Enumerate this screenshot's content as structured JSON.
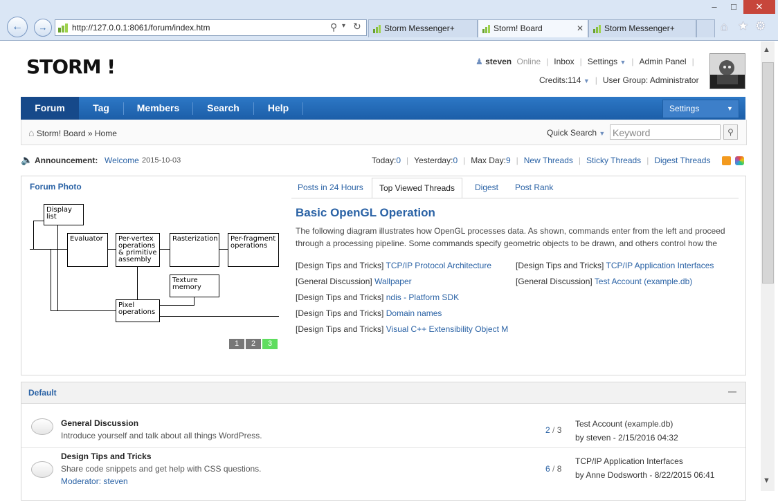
{
  "browser": {
    "url": "http://127.0.0.1:8061/forum/index.htm",
    "tabs": [
      {
        "title": "Storm Messenger+",
        "active": false
      },
      {
        "title": "Storm! Board",
        "active": true
      },
      {
        "title": "Storm Messenger+",
        "active": false
      }
    ],
    "win_controls": {
      "minimize": "–",
      "maximize": "□",
      "close": "✕"
    }
  },
  "header": {
    "logo": "STORM !",
    "user": {
      "name": "steven",
      "status": "Online",
      "inbox": "Inbox",
      "settings": "Settings",
      "admin": "Admin Panel"
    },
    "credits_label": "Credits:",
    "credits_value": "114",
    "user_group": "User Group: Administrator"
  },
  "nav": {
    "items": [
      "Forum",
      "Tag",
      "Members",
      "Search",
      "Help"
    ],
    "settings": "Settings"
  },
  "breadcrumb": {
    "root": "Storm! Board",
    "sep": "»",
    "current": "Home"
  },
  "quick_search": {
    "label": "Quick Search",
    "placeholder": "Keyword"
  },
  "announcement": {
    "label": "Announcement:",
    "text": "Welcome",
    "date": "2015-10-03",
    "today_label": "Today:",
    "today": "0",
    "yesterday_label": "Yesterday:",
    "yesterday": "0",
    "maxday_label": "Max Day:",
    "maxday": "9",
    "links": [
      "New Threads",
      "Sticky Threads",
      "Digest Threads"
    ]
  },
  "photo": {
    "title": "Forum Photo",
    "tabs": [
      "Posts in 24 Hours",
      "Top Viewed Threads",
      "Digest",
      "Post Rank"
    ],
    "pages": [
      "1",
      "2",
      "3"
    ],
    "diagram": {
      "display_list": "Display list",
      "evaluator": "Evaluator",
      "per_vertex": "Per-vertex operations & primitive assembly",
      "rasterization": "Rasterization",
      "per_fragment": "Per-fragment operations",
      "texture": "Texture memory",
      "pixel": "Pixel operations"
    },
    "article_title": "Basic OpenGL Operation",
    "article_text": "The following diagram illustrates how OpenGL processes data. As shown, commands enter from the left and proceed through a processing pipeline. Some commands specify geometric objects to be drawn, and others control how the",
    "threads_left": [
      {
        "cat": "[Design Tips and Tricks]",
        "title": "TCP/IP Protocol Architecture"
      },
      {
        "cat": "[General Discussion]",
        "title": "Wallpaper"
      },
      {
        "cat": "[Design Tips and Tricks]",
        "title": "ndis - Platform SDK"
      },
      {
        "cat": "[Design Tips and Tricks]",
        "title": "Domain names"
      },
      {
        "cat": "[Design Tips and Tricks]",
        "title": "Visual C++ Extensibility Object M"
      }
    ],
    "threads_right": [
      {
        "cat": "[Design Tips and Tricks]",
        "title": "TCP/IP Application Interfaces"
      },
      {
        "cat": "[General Discussion]",
        "title": "Test Account (example.db)"
      }
    ]
  },
  "forums": {
    "section": "Default",
    "collapse": "—",
    "rows": [
      {
        "name": "General Discussion",
        "desc": "Introduce yourself and talk about all things WordPress.",
        "threads": "2",
        "posts": "3",
        "last_title": "Test Account (example.db)",
        "last_by": "by steven - 2/15/2016 04:32",
        "moderator_label": "",
        "moderator": ""
      },
      {
        "name": "Design Tips and Tricks",
        "desc": "Share code snippets and get help with CSS questions.",
        "threads": "6",
        "posts": "8",
        "last_title": "TCP/IP Application Interfaces",
        "last_by": "by Anne Dodsworth - 8/22/2015 06:41",
        "moderator_label": "Moderator:",
        "moderator": "steven"
      }
    ]
  }
}
